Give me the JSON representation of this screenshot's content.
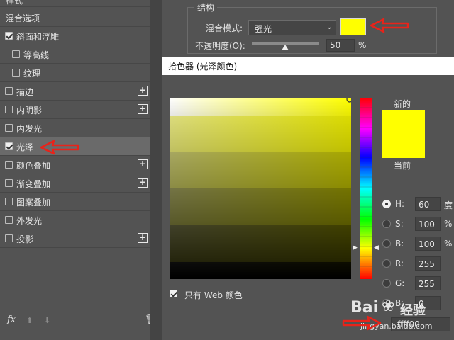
{
  "left_panel": {
    "header_partial": "样式",
    "blend_options": "混合选项",
    "items": [
      {
        "label": "斜面和浮雕",
        "checked": true,
        "plus": false,
        "indent": false
      },
      {
        "label": "等高线",
        "checked": false,
        "plus": false,
        "indent": true
      },
      {
        "label": "纹理",
        "checked": false,
        "plus": false,
        "indent": true
      },
      {
        "label": "描边",
        "checked": false,
        "plus": true,
        "indent": false
      },
      {
        "label": "内阴影",
        "checked": false,
        "plus": true,
        "indent": false
      },
      {
        "label": "内发光",
        "checked": false,
        "plus": false,
        "indent": false
      },
      {
        "label": "光泽",
        "checked": true,
        "plus": false,
        "indent": false,
        "selected": true
      },
      {
        "label": "颜色叠加",
        "checked": false,
        "plus": true,
        "indent": false
      },
      {
        "label": "渐变叠加",
        "checked": false,
        "plus": true,
        "indent": false
      },
      {
        "label": "图案叠加",
        "checked": false,
        "plus": false,
        "indent": false
      },
      {
        "label": "外发光",
        "checked": false,
        "plus": false,
        "indent": false
      },
      {
        "label": "投影",
        "checked": false,
        "plus": true,
        "indent": false
      }
    ],
    "fx_label": "fx"
  },
  "structure": {
    "title": "结构",
    "blend_mode_label": "混合模式:",
    "blend_mode_value": "强光",
    "opacity_label": "不透明度(O):",
    "opacity_value": "50",
    "opacity_unit": "%",
    "opacity_fraction": 0.5,
    "swatch_color": "#ffff00"
  },
  "color_picker": {
    "title": "拾色器 (光泽颜色)",
    "new_label": "新的",
    "current_label": "当前",
    "new_color": "#ffff00",
    "current_color": "#ffff00",
    "web_only_label": "只有 Web 颜色",
    "web_only_checked": true,
    "fields": [
      {
        "label": "H:",
        "value": "60",
        "unit": "度",
        "radio_on": true
      },
      {
        "label": "S:",
        "value": "100",
        "unit": "%",
        "radio_on": false
      },
      {
        "label": "B:",
        "value": "100",
        "unit": "%",
        "radio_on": false
      },
      {
        "label": "R:",
        "value": "255",
        "unit": "",
        "radio_on": false
      },
      {
        "label": "G:",
        "value": "255",
        "unit": "",
        "radio_on": false
      },
      {
        "label": "B:",
        "value": "0",
        "unit": "",
        "radio_on": false
      }
    ],
    "hex_value": "ffff00"
  },
  "watermark": {
    "brand": "Bai",
    "brand2": "经验",
    "url": "jingyan.baidu.com"
  },
  "colors": {
    "arrow": "#e8231a",
    "panel": "#535353",
    "accent_yellow": "#ffff00"
  }
}
